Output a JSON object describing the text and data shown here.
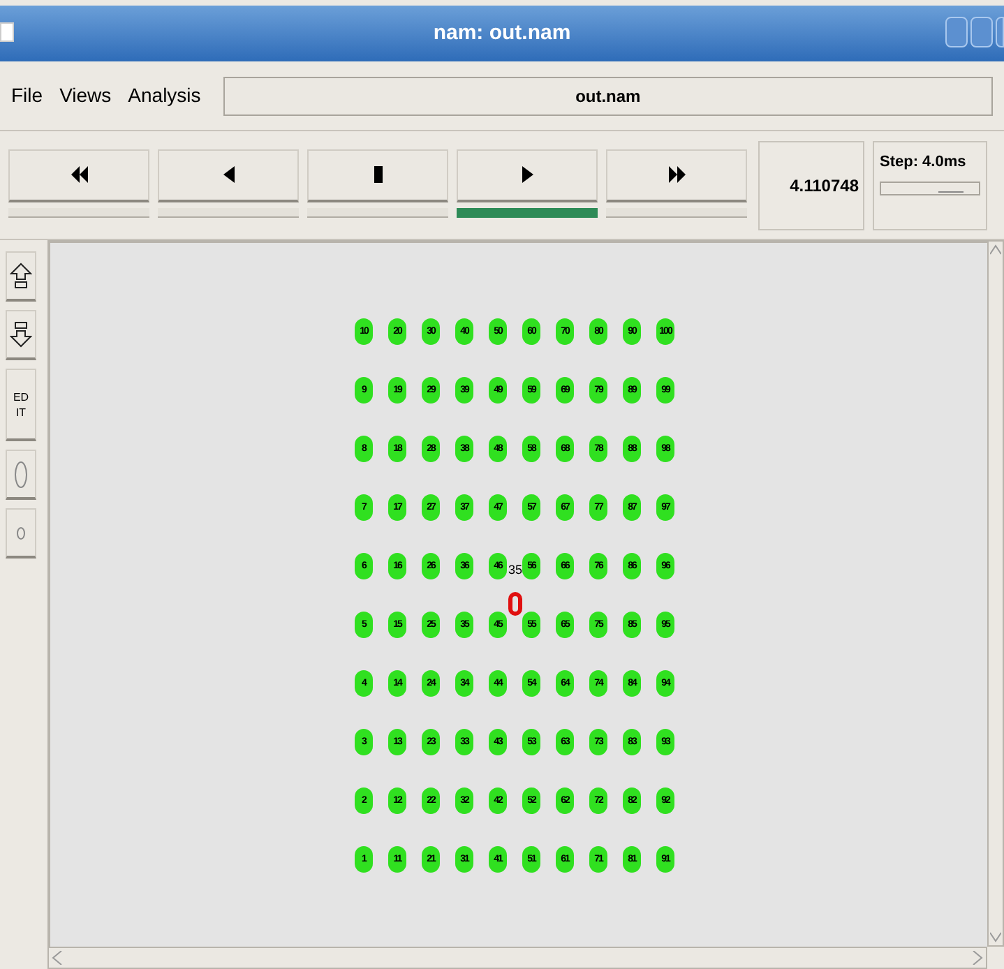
{
  "window": {
    "title": "nam: out.nam"
  },
  "menu": [
    {
      "label": "File"
    },
    {
      "label": "Views"
    },
    {
      "label": "Analysis"
    }
  ],
  "file_name": "out.nam",
  "transport": [
    {
      "kind": "rewind",
      "selected": false
    },
    {
      "kind": "back",
      "selected": false
    },
    {
      "kind": "stop",
      "selected": false
    },
    {
      "kind": "play",
      "selected": true
    },
    {
      "kind": "forward",
      "selected": false
    }
  ],
  "time": "4.110748",
  "step": {
    "label": "Step: 4.0ms",
    "level": 0.72
  },
  "tools": [
    {
      "kind": "zoom_in"
    },
    {
      "kind": "zoom_out"
    },
    {
      "kind": "edit",
      "label": "EDIT"
    },
    {
      "kind": "large_circle"
    },
    {
      "kind": "small_circle"
    }
  ],
  "node_rows": [
    [
      "10",
      "20",
      "30",
      "40",
      "50",
      "60",
      "70",
      "80",
      "90",
      "100"
    ],
    [
      "9",
      "19",
      "29",
      "39",
      "49",
      "59",
      "69",
      "79",
      "89",
      "99"
    ],
    [
      "8",
      "18",
      "28",
      "38",
      "48",
      "58",
      "68",
      "78",
      "88",
      "98"
    ],
    [
      "7",
      "17",
      "27",
      "37",
      "47",
      "57",
      "67",
      "77",
      "87",
      "97"
    ],
    [
      "6",
      "16",
      "26",
      "36",
      "46",
      "56",
      "66",
      "76",
      "86",
      "96"
    ],
    [
      "5",
      "15",
      "25",
      "35",
      "45",
      "55",
      "65",
      "75",
      "85",
      "95"
    ],
    [
      "4",
      "14",
      "24",
      "34",
      "44",
      "54",
      "64",
      "74",
      "84",
      "94"
    ],
    [
      "3",
      "13",
      "23",
      "33",
      "43",
      "53",
      "63",
      "73",
      "83",
      "93"
    ],
    [
      "2",
      "12",
      "22",
      "32",
      "42",
      "52",
      "62",
      "72",
      "82",
      "92"
    ],
    [
      "1",
      "11",
      "21",
      "31",
      "41",
      "51",
      "61",
      "71",
      "81",
      "91"
    ]
  ],
  "mobile_node": {
    "caption": "35",
    "color": "#e01010"
  }
}
